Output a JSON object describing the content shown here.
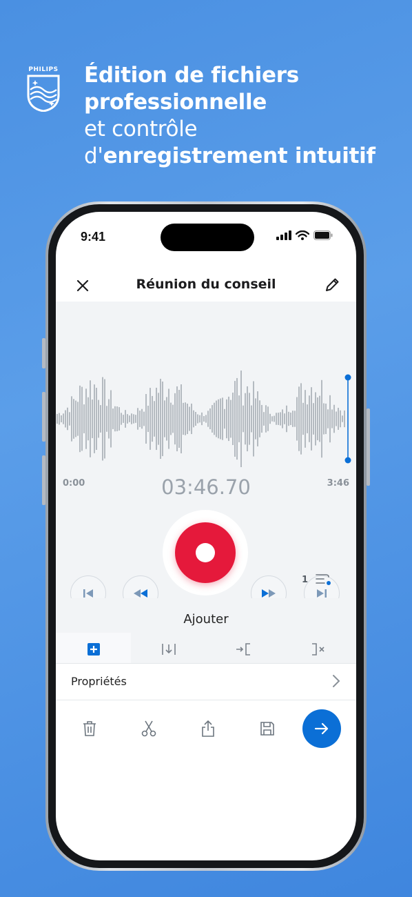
{
  "brand": {
    "name": "PHILIPS"
  },
  "headline": {
    "line1_bold": "Édition de fichiers",
    "line2_bold": "professionnelle",
    "line3": "et contrôle",
    "line4_prefix": "d'",
    "line4_bold": "enregistrement intuitif"
  },
  "status_bar": {
    "time": "9:41"
  },
  "nav": {
    "title": "Réunion du conseil",
    "close_icon": "close-icon",
    "edit_icon": "pencil-icon"
  },
  "player": {
    "start_time": "0:00",
    "end_time": "3:46",
    "current_time": "03:46.70",
    "speed_value": "1"
  },
  "add_panel": {
    "title": "Ajouter",
    "tools": [
      {
        "icon": "add-square-icon",
        "active": true
      },
      {
        "icon": "insert-icon",
        "active": false
      },
      {
        "icon": "overwrite-icon",
        "active": false
      },
      {
        "icon": "delete-to-end-icon",
        "active": false
      }
    ]
  },
  "properties": {
    "label": "Propriétés"
  },
  "bottom_bar": {
    "icons": [
      "trash-icon",
      "scissors-icon",
      "share-icon",
      "save-icon",
      "send-arrow-icon"
    ]
  },
  "colors": {
    "accent": "#0b6fd6",
    "record": "#e5193b",
    "background": "#4a90e2"
  }
}
